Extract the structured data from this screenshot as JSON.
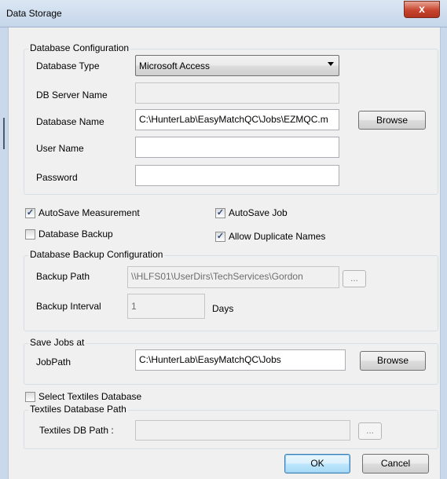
{
  "window": {
    "title": "Data Storage",
    "close_glyph": "x"
  },
  "db_config": {
    "legend": "Database Configuration",
    "type_label": "Database Type",
    "type_value": "Microsoft Access",
    "server_label": "DB Server Name",
    "server_value": "",
    "name_label": "Database Name",
    "name_value": "C:\\HunterLab\\EasyMatchQC\\Jobs\\EZMQC.m",
    "browse_label": "Browse",
    "user_label": "User Name",
    "user_value": "",
    "password_label": "Password",
    "password_value": ""
  },
  "options": {
    "autosave_measurement": {
      "label": "AutoSave Measurement",
      "checked": true
    },
    "autosave_job": {
      "label": "AutoSave Job",
      "checked": true
    },
    "database_backup": {
      "label": "Database Backup",
      "checked": false
    },
    "allow_duplicate": {
      "label": "Allow Duplicate Names",
      "checked": true
    }
  },
  "backup": {
    "legend": "Database Backup Configuration",
    "path_label": "Backup Path",
    "path_value": "\\\\HLFS01\\UserDirs\\TechServices\\Gordon",
    "dots_label": "...",
    "interval_label": "Backup Interval",
    "interval_value": "1",
    "days_label": "Days"
  },
  "jobs": {
    "legend": "Save Jobs at",
    "path_label": "JobPath",
    "path_value": "C:\\HunterLab\\EasyMatchQC\\Jobs",
    "browse_label": "Browse"
  },
  "textiles": {
    "checkbox_label": "Select Textiles Database",
    "checked": false,
    "legend": "Textiles Database Path",
    "path_label": "Textiles DB Path :",
    "path_value": "",
    "dots_label": "..."
  },
  "footer": {
    "ok_label": "OK",
    "cancel_label": "Cancel"
  }
}
